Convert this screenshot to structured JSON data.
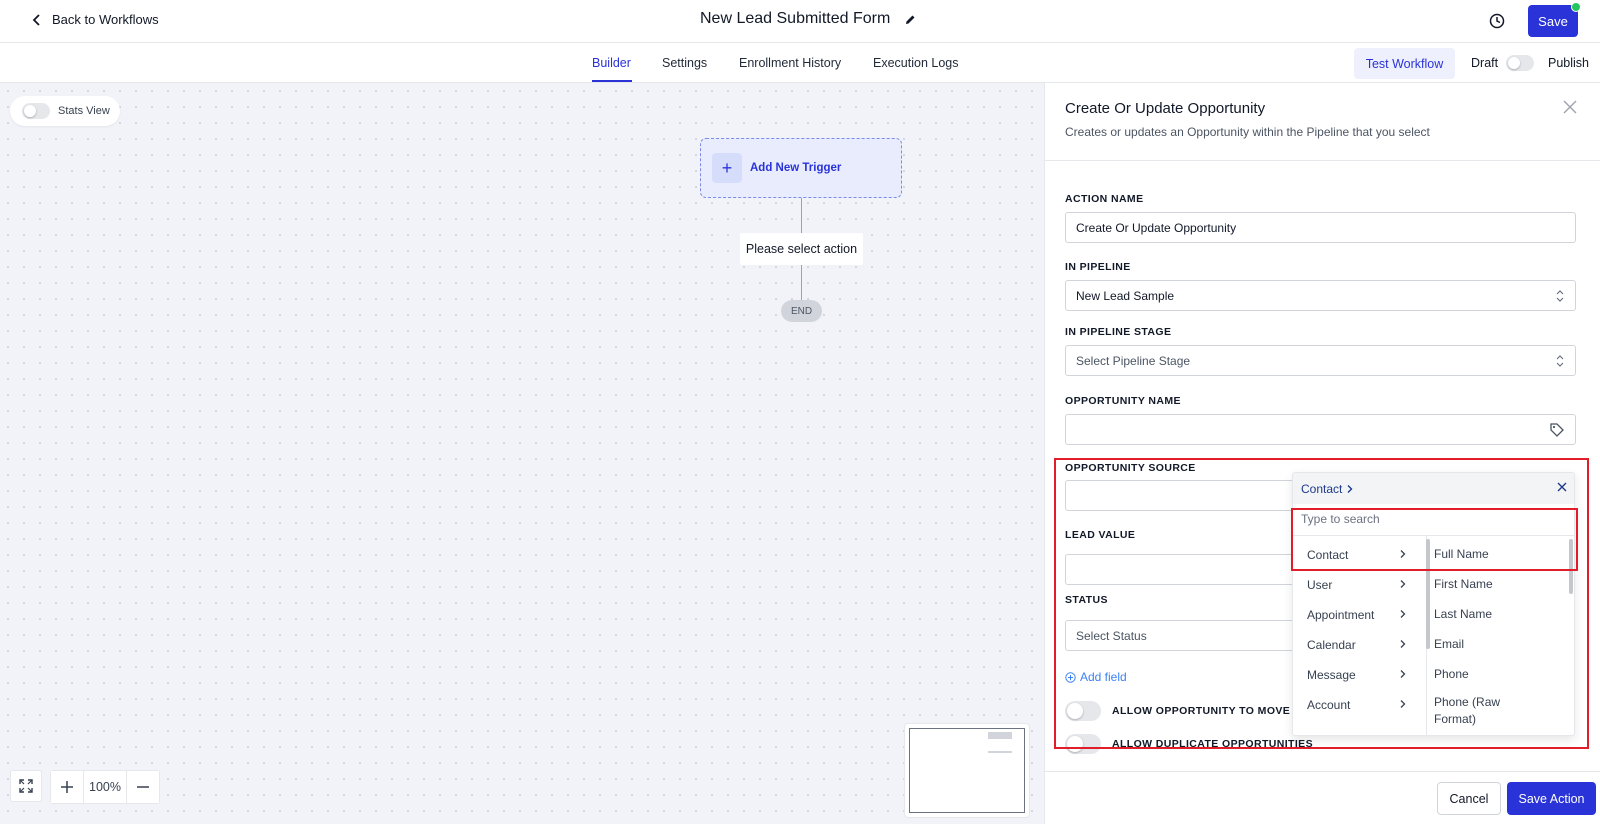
{
  "header": {
    "back_label": "Back to Workflows",
    "title": "New Lead Submitted Form",
    "save_label": "Save"
  },
  "tabs": [
    {
      "label": "Builder",
      "active": true
    },
    {
      "label": "Settings",
      "active": false
    },
    {
      "label": "Enrollment History",
      "active": false
    },
    {
      "label": "Execution Logs",
      "active": false
    }
  ],
  "toolbar": {
    "test_label": "Test Workflow",
    "draft_label": "Draft",
    "publish_label": "Publish"
  },
  "canvas": {
    "stats_label": "Stats View",
    "trigger_label": "Add New Trigger",
    "action_placeholder": "Please select action",
    "end_label": "END",
    "zoom_label": "100%"
  },
  "panel": {
    "title": "Create Or Update Opportunity",
    "subtitle": "Creates or updates an Opportunity within the Pipeline that you select",
    "fields": {
      "action_name": {
        "label": "ACTION NAME",
        "value": "Create Or Update Opportunity"
      },
      "pipeline": {
        "label": "IN PIPELINE",
        "value": "New Lead Sample"
      },
      "pipeline_stage": {
        "label": "IN PIPELINE STAGE",
        "placeholder": "Select Pipeline Stage"
      },
      "opportunity_name": {
        "label": "OPPORTUNITY NAME",
        "value": ""
      },
      "opportunity_source": {
        "label": "OPPORTUNITY SOURCE",
        "value": ""
      },
      "lead_value": {
        "label": "LEAD VALUE",
        "value": ""
      },
      "status": {
        "label": "STATUS",
        "placeholder": "Select Status"
      }
    },
    "add_field_label": "Add field",
    "switches": {
      "allow_move": "ALLOW OPPORTUNITY TO MOVE T",
      "allow_duplicate": "ALLOW DUPLICATE OPPORTUNITIES"
    },
    "cancel_label": "Cancel",
    "save_action_label": "Save Action"
  },
  "dropdown": {
    "breadcrumb": "Contact",
    "search_placeholder": "Type to search",
    "categories": [
      "Contact",
      "User",
      "Appointment",
      "Calendar",
      "Message",
      "Account"
    ],
    "contact_fields": [
      "Full Name",
      "First Name",
      "Last Name",
      "Email",
      "Phone",
      "Phone (Raw Format)"
    ]
  },
  "colors": {
    "primary": "#2933d8",
    "highlight": "#e11d2a",
    "canvas_bg": "#f1f3f8"
  }
}
